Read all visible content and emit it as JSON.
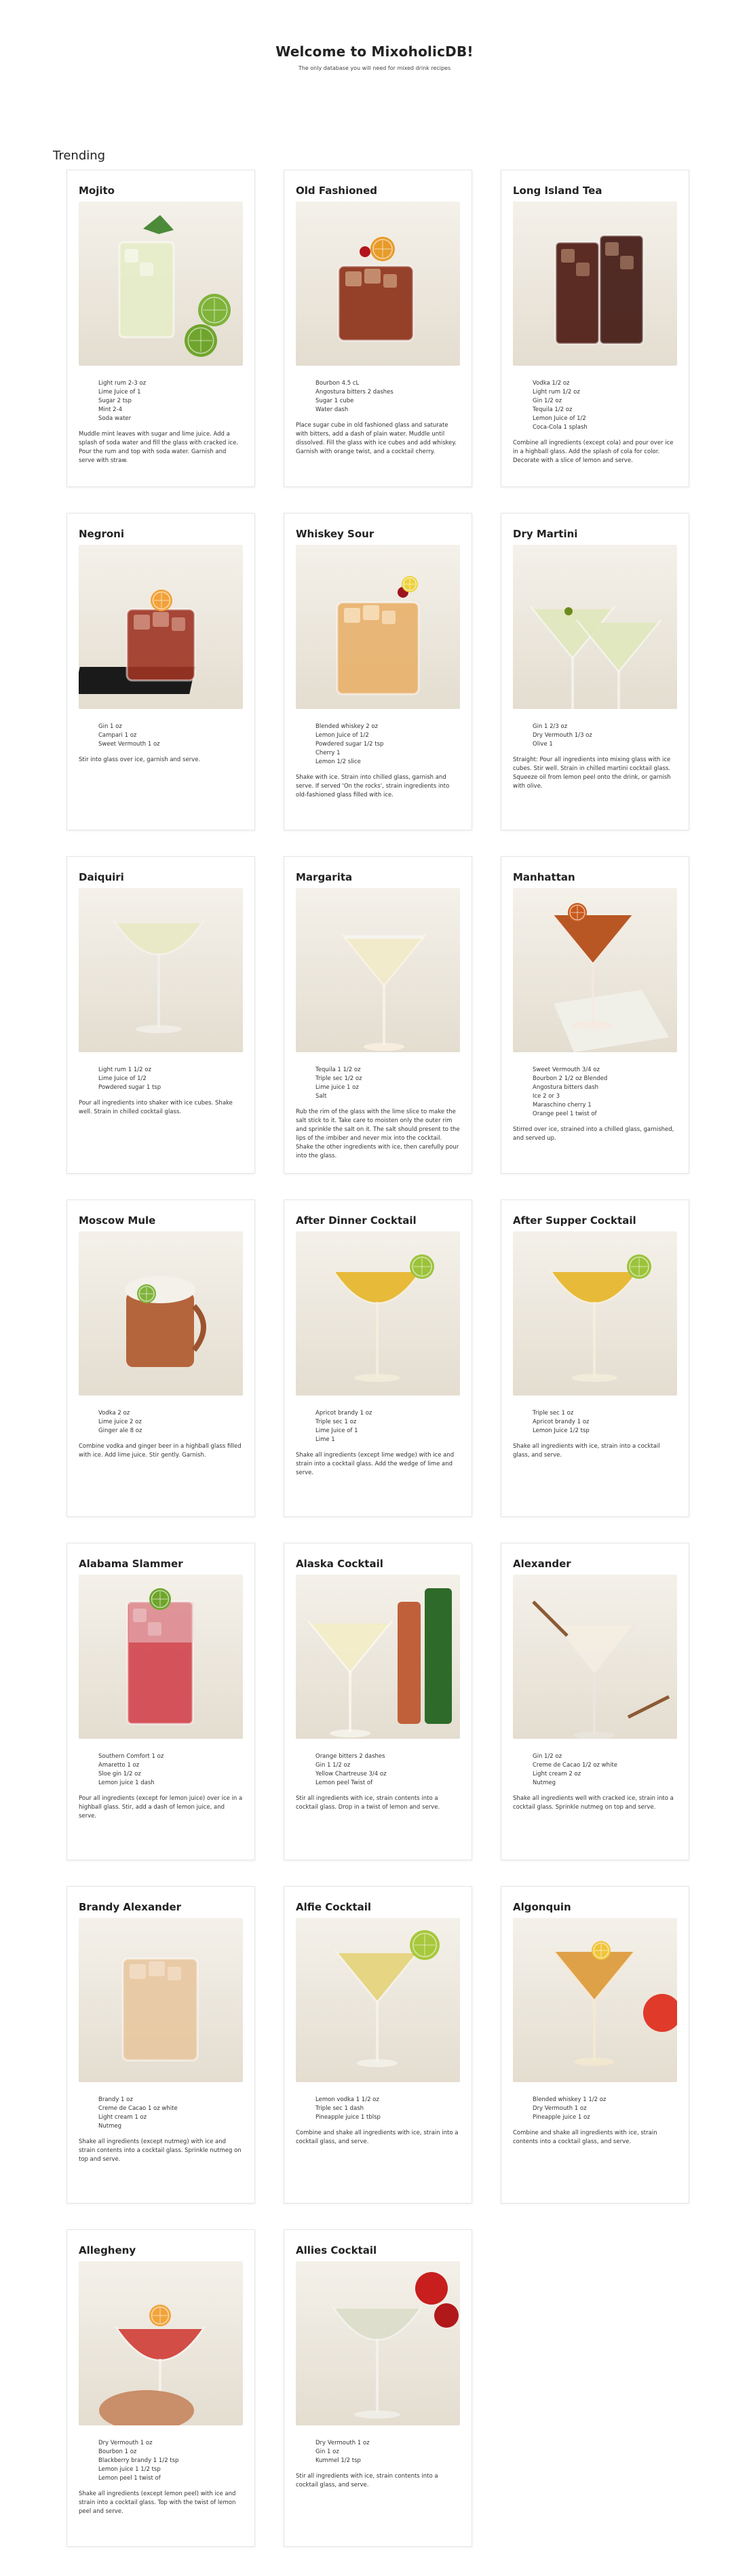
{
  "header": {
    "title": "Welcome to MixoholicDB!",
    "subtitle": "The only database you will need for mixed drink recipes"
  },
  "trending": {
    "heading": "Trending",
    "drinks": [
      {
        "name": "Mojito",
        "image": "mojito-photo",
        "ingredients": [
          "Light rum 2-3 oz",
          "Lime Juice of 1",
          "Sugar 2 tsp",
          "Mint 2-4",
          "Soda water"
        ],
        "instructions": "Muddle mint leaves with sugar and lime juice. Add a splash of soda water and fill the glass with cracked ice. Pour the rum and top with soda water. Garnish and serve with straw."
      },
      {
        "name": "Old Fashioned",
        "image": "old-fashioned-photo",
        "ingredients": [
          "Bourbon 4.5 cL",
          "Angostura bitters 2 dashes",
          "Sugar 1 cube",
          "Water dash"
        ],
        "instructions": "Place sugar cube in old fashioned glass and saturate with bitters, add a dash of plain water. Muddle until dissolved. Fill the glass with ice cubes and add whiskey. Garnish with orange twist, and a cocktail cherry."
      },
      {
        "name": "Long Island Tea",
        "image": "long-island-tea-photo",
        "ingredients": [
          "Vodka 1/2 oz",
          "Light rum 1/2 oz",
          "Gin 1/2 oz",
          "Tequila 1/2 oz",
          "Lemon Juice of 1/2",
          "Coca-Cola 1 splash"
        ],
        "instructions": "Combine all ingredients (except cola) and pour over ice in a highball glass. Add the splash of cola for color. Decorate with a slice of lemon and serve."
      },
      {
        "name": "Negroni",
        "image": "negroni-photo",
        "ingredients": [
          "Gin 1 oz",
          "Campari 1 oz",
          "Sweet Vermouth 1 oz"
        ],
        "instructions": "Stir into glass over ice, garnish and serve."
      },
      {
        "name": "Whiskey Sour",
        "image": "whiskey-sour-photo",
        "ingredients": [
          "Blended whiskey 2 oz",
          "Lemon Juice of 1/2",
          "Powdered sugar 1/2 tsp",
          "Cherry 1",
          "Lemon 1/2 slice"
        ],
        "instructions": "Shake with ice. Strain into chilled glass, garnish and serve. If served 'On the rocks', strain ingredients into old-fashioned glass filled with ice."
      },
      {
        "name": "Dry Martini",
        "image": "dry-martini-photo",
        "ingredients": [
          "Gin 1 2/3 oz",
          "Dry Vermouth 1/3 oz",
          "Olive 1"
        ],
        "instructions": "Straight: Pour all ingredients into mixing glass with ice cubes. Stir well. Strain in chilled martini cocktail glass. Squeeze oil from lemon peel onto the drink, or garnish with olive."
      },
      {
        "name": "Daiquiri",
        "image": "daiquiri-photo",
        "ingredients": [
          "Light rum 1 1/2 oz",
          "Lime Juice of 1/2",
          "Powdered sugar 1 tsp"
        ],
        "instructions": "Pour all ingredients into shaker with ice cubes. Shake well. Strain in chilled cocktail glass."
      },
      {
        "name": "Margarita",
        "image": "margarita-photo",
        "ingredients": [
          "Tequila 1 1/2 oz",
          "Triple sec 1/2 oz",
          "Lime juice 1 oz",
          "Salt"
        ],
        "instructions": "Rub the rim of the glass with the lime slice to make the salt stick to it. Take care to moisten only the outer rim and sprinkle the salt on it. The salt should present to the lips of the imbiber and never mix into the cocktail. Shake the other ingredients with ice, then carefully pour into the glass."
      },
      {
        "name": "Manhattan",
        "image": "manhattan-photo",
        "ingredients": [
          "Sweet Vermouth 3/4 oz",
          "Bourbon 2 1/2 oz Blended",
          "Angostura bitters dash",
          "Ice 2 or 3",
          "Maraschino cherry 1",
          "Orange peel 1 twist of"
        ],
        "instructions": "Stirred over ice, strained into a chilled glass, garnished, and served up."
      },
      {
        "name": "Moscow Mule",
        "image": "moscow-mule-photo",
        "ingredients": [
          "Vodka 2 oz",
          "Lime juice 2 oz",
          "Ginger ale 8 oz"
        ],
        "instructions": "Combine vodka and ginger beer in a highball glass filled with ice. Add lime juice. Stir gently. Garnish."
      },
      {
        "name": "After Dinner Cocktail",
        "image": "after-dinner-cocktail-photo",
        "ingredients": [
          "Apricot brandy 1 oz",
          "Triple sec 1 oz",
          "Lime Juice of 1",
          "Lime 1"
        ],
        "instructions": "Shake all ingredients (except lime wedge) with ice and strain into a cocktail glass. Add the wedge of lime and serve."
      },
      {
        "name": "After Supper Cocktail",
        "image": "after-supper-cocktail-photo",
        "ingredients": [
          "Triple sec 1 oz",
          "Apricot brandy 1 oz",
          "Lemon Juice 1/2 tsp"
        ],
        "instructions": "Shake all ingredients with ice, strain into a cocktail glass, and serve."
      },
      {
        "name": "Alabama Slammer",
        "image": "alabama-slammer-photo",
        "ingredients": [
          "Southern Comfort 1 oz",
          "Amaretto 1 oz",
          "Sloe gin 1/2 oz",
          "Lemon juice 1 dash"
        ],
        "instructions": "Pour all ingredients (except for lemon juice) over ice in a highball glass. Stir, add a dash of lemon juice, and serve."
      },
      {
        "name": "Alaska Cocktail",
        "image": "alaska-cocktail-photo",
        "ingredients": [
          "Orange bitters 2 dashes",
          "Gin 1 1/2 oz",
          "Yellow Chartreuse 3/4 oz",
          "Lemon peel Twist of"
        ],
        "instructions": "Stir all ingredients with ice, strain contents into a cocktail glass. Drop in a twist of lemon and serve."
      },
      {
        "name": "Alexander",
        "image": "alexander-photo",
        "ingredients": [
          "Gin 1/2 oz",
          "Creme de Cacao 1/2 oz white",
          "Light cream 2 oz",
          "Nutmeg"
        ],
        "instructions": "Shake all ingredients well with cracked ice, strain into a cocktail glass. Sprinkle nutmeg on top and serve."
      },
      {
        "name": "Brandy Alexander",
        "image": "brandy-alexander-photo",
        "ingredients": [
          "Brandy 1 oz",
          "Creme de Cacao 1 oz white",
          "Light cream 1 oz",
          "Nutmeg"
        ],
        "instructions": "Shake all ingredients (except nutmeg) with ice and strain contents into a cocktail glass. Sprinkle nutmeg on top and serve."
      },
      {
        "name": "Alfie Cocktail",
        "image": "alfie-cocktail-photo",
        "ingredients": [
          "Lemon vodka 1 1/2 oz",
          "Triple sec 1 dash",
          "Pineapple juice 1 tblsp"
        ],
        "instructions": "Combine and shake all ingredients with ice, strain into a cocktail glass, and serve."
      },
      {
        "name": "Algonquin",
        "image": "algonquin-photo",
        "ingredients": [
          "Blended whiskey 1 1/2 oz",
          "Dry Vermouth 1 oz",
          "Pineapple juice 1 oz"
        ],
        "instructions": "Combine and shake all ingredients with ice, strain contents into a cocktail glass, and serve."
      },
      {
        "name": "Allegheny",
        "image": "allegheny-photo",
        "ingredients": [
          "Dry Vermouth 1 oz",
          "Bourbon 1 oz",
          "Blackberry brandy 1 1/2 tsp",
          "Lemon juice 1 1/2 tsp",
          "Lemon peel 1 twist of"
        ],
        "instructions": "Shake all ingredients (except lemon peel) with ice and strain into a cocktail glass. Top with the twist of lemon peel and serve."
      },
      {
        "name": "Allies Cocktail",
        "image": "allies-cocktail-photo",
        "ingredients": [
          "Dry Vermouth 1 oz",
          "Gin 1 oz",
          "Kummel 1/2 tsp"
        ],
        "instructions": "Stir all ingredients with ice, strain contents into a cocktail glass, and serve."
      }
    ]
  }
}
